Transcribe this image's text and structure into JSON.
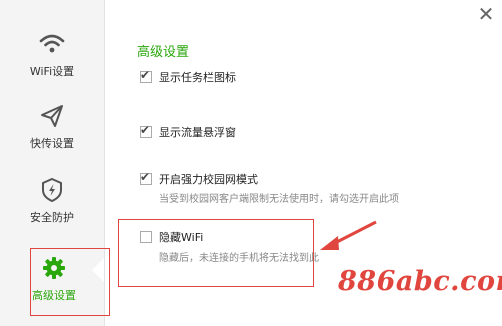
{
  "sidebar": {
    "items": [
      {
        "label": "WiFi设置",
        "icon": "wifi-icon"
      },
      {
        "label": "快传设置",
        "icon": "send-icon"
      },
      {
        "label": "安全防护",
        "icon": "shield-icon"
      },
      {
        "label": "高级设置",
        "icon": "gear-icon",
        "active": true
      }
    ]
  },
  "window": {
    "close_icon": "close-icon",
    "close_glyph": "✕"
  },
  "main": {
    "title": "高级设置",
    "options": [
      {
        "label": "显示任务栏图标",
        "checked": true
      },
      {
        "label": "显示流量悬浮窗",
        "checked": true
      },
      {
        "label": "开启强力校园网模式",
        "checked": true,
        "description": "当受到校园网客户端限制无法使用时，请勾选开启此项"
      },
      {
        "label": "隐藏WiFi",
        "checked": false,
        "description": "隐藏后，未连接的手机将无法找到此"
      }
    ]
  },
  "watermark": {
    "text": "886abc.com"
  },
  "colors": {
    "accent": "#2aa70c",
    "highlight": "#e0453e",
    "sidebar_bg": "#f4f4f4"
  }
}
